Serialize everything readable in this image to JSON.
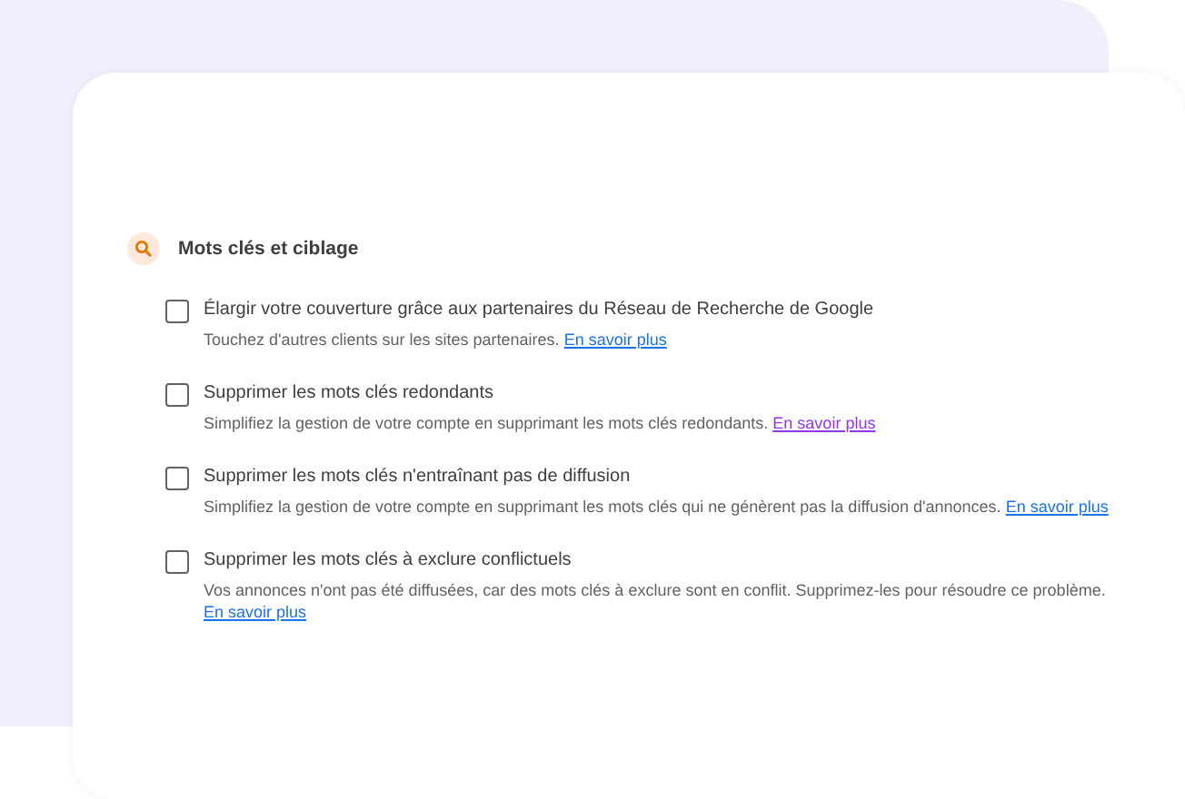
{
  "section": {
    "title": "Mots clés et ciblage"
  },
  "options": [
    {
      "label": "Élargir votre couverture grâce aux partenaires du Réseau de Recherche de Google",
      "description": "Touchez d'autres clients sur les sites partenaires.",
      "link": {
        "text": "En savoir plus",
        "visited": false
      },
      "checked": false
    },
    {
      "label": "Supprimer les mots clés redondants",
      "description": "Simplifiez la gestion de votre compte en supprimant les mots clés redondants.",
      "link": {
        "text": "En savoir plus",
        "visited": true
      },
      "checked": false
    },
    {
      "label": "Supprimer les mots clés n'entraînant pas de diffusion",
      "description": "Simplifiez la gestion de votre compte en supprimant les mots clés qui ne génèrent pas la diffusion d'annonces.",
      "link": {
        "text": "En savoir plus",
        "visited": false
      },
      "checked": false
    },
    {
      "label": "Supprimer les mots clés à exclure conflictuels",
      "description": "Vos annonces n'ont pas été diffusées, car des mots clés à exclure sont en conflit. Supprimez-les pour résoudre ce problème.",
      "link": {
        "text": "En savoir plus",
        "visited": false
      },
      "checked": false
    }
  ]
}
